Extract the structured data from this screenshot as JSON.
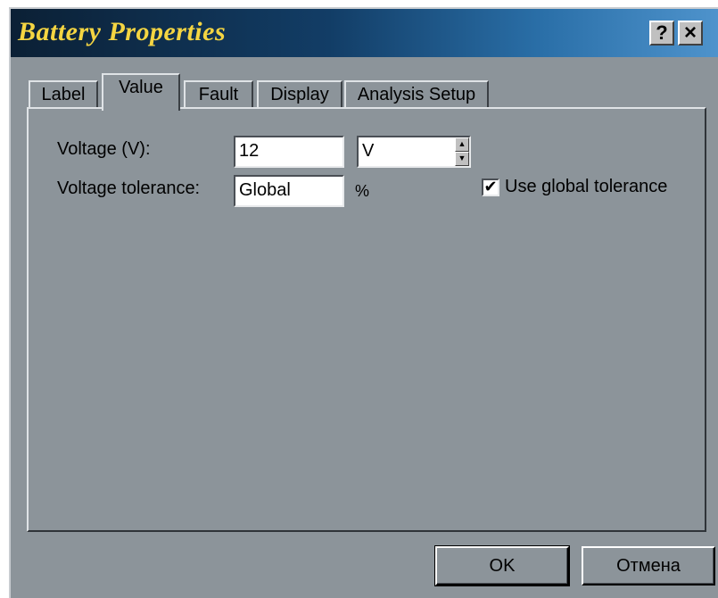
{
  "window": {
    "title": "Battery Properties",
    "help_glyph": "?",
    "close_glyph": "×"
  },
  "tabs": [
    {
      "label": "Label",
      "active": false
    },
    {
      "label": "Value",
      "active": true
    },
    {
      "label": "Fault",
      "active": false
    },
    {
      "label": "Display",
      "active": false
    },
    {
      "label": "Analysis Setup",
      "active": false
    }
  ],
  "value_tab": {
    "voltage_label": "Voltage (V):",
    "voltage_value": "12",
    "voltage_unit": "V",
    "tolerance_label": "Voltage tolerance:",
    "tolerance_value": "Global",
    "tolerance_unit": "%",
    "use_global_label": "Use global tolerance",
    "use_global_checked": true,
    "check_glyph": "✔"
  },
  "buttons": {
    "ok": "OK",
    "cancel": "Отмена"
  },
  "colors": {
    "face": "#8c949a",
    "title_text": "#f4d542",
    "title_bar_start": "#0b2035",
    "title_bar_end": "#4e93cc"
  }
}
